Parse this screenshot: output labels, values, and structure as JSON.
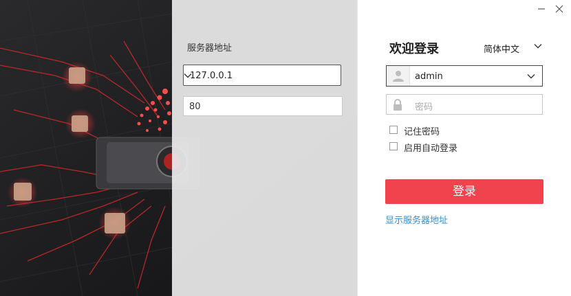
{
  "server": {
    "label": "服务器地址",
    "ip_value": "127.0.0.1",
    "port_value": "80"
  },
  "login": {
    "welcome": "欢迎登录",
    "language": "简体中文",
    "username": "admin",
    "password_placeholder": "密码",
    "remember_password": "记住密码",
    "auto_login": "启用自动登录",
    "login_button": "登录",
    "show_server_link": "显示服务器地址"
  },
  "colors": {
    "accent": "#f0434e",
    "link": "#2f8fd8"
  },
  "icons": [
    "chevron-down-icon",
    "user-icon",
    "lock-icon",
    "minimize-icon",
    "close-icon"
  ]
}
